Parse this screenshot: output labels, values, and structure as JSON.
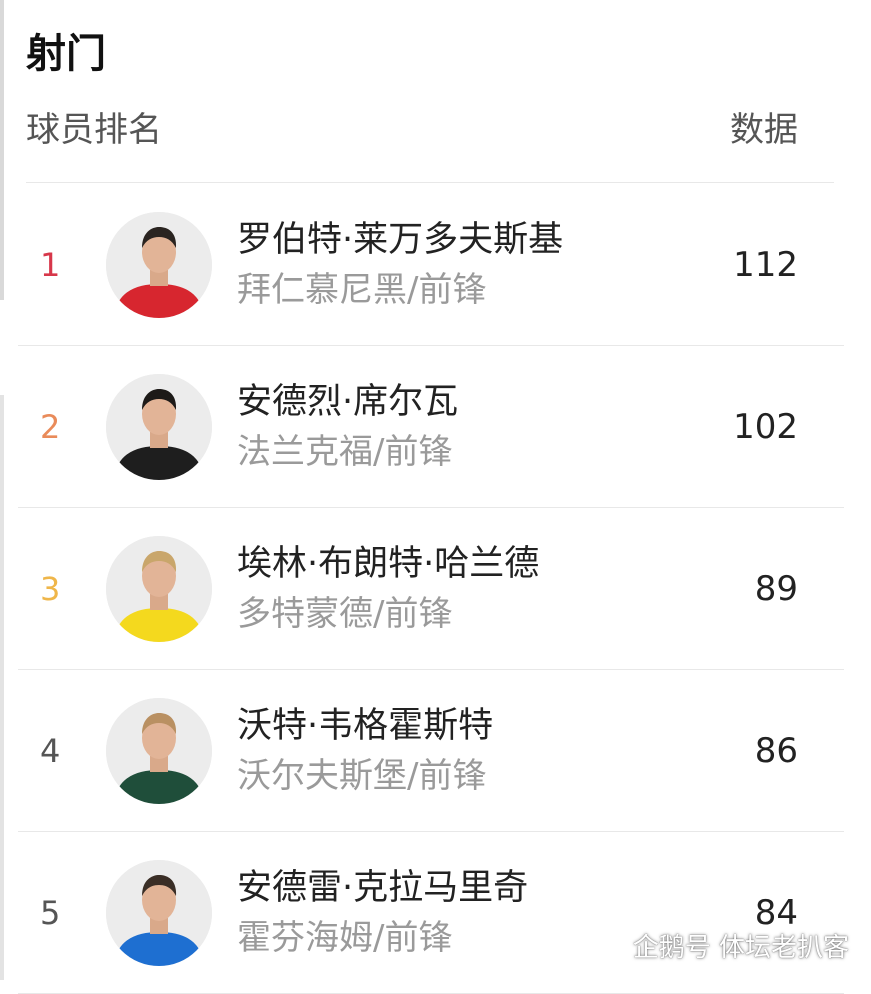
{
  "title": "射门",
  "header": {
    "left": "球员排名",
    "right": "数据"
  },
  "rows": [
    {
      "rank": "1",
      "rank_color": "#d7374a",
      "name": "罗伯特·莱万多夫斯基",
      "club": "拜仁慕尼黑/前锋",
      "value": "112",
      "kit_color": "#d7262f",
      "hair_color": "#2a2420"
    },
    {
      "rank": "2",
      "rank_color": "#e98b5a",
      "name": "安德烈·席尔瓦",
      "club": "法兰克福/前锋",
      "value": "102",
      "kit_color": "#1e1e1e",
      "hair_color": "#1d1a18"
    },
    {
      "rank": "3",
      "rank_color": "#efb64a",
      "name": "埃林·布朗特·哈兰德",
      "club": "多特蒙德/前锋",
      "value": "89",
      "kit_color": "#f4d91e",
      "hair_color": "#c9a66b"
    },
    {
      "rank": "4",
      "rank_color": "#555555",
      "name": "沃特·韦格霍斯特",
      "club": "沃尔夫斯堡/前锋",
      "value": "86",
      "kit_color": "#1f4e3a",
      "hair_color": "#b99062"
    },
    {
      "rank": "5",
      "rank_color": "#555555",
      "name": "安德雷·克拉马里奇",
      "club": "霍芬海姆/前锋",
      "value": "84",
      "kit_color": "#1e6fd1",
      "hair_color": "#3a2e26"
    }
  ],
  "watermark": "企鹅号 体坛老扒客"
}
